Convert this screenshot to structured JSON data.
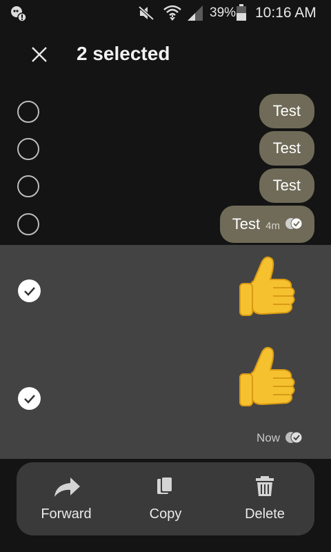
{
  "status_bar": {
    "battery_percent": "39%",
    "time": "10:16 AM",
    "icons": [
      "notification-icon",
      "mute-icon",
      "wifi-icon",
      "signal-icon",
      "battery-icon"
    ]
  },
  "header": {
    "title": "2 selected",
    "close_icon": "close-icon"
  },
  "messages": [
    {
      "text": "Test",
      "selected": false
    },
    {
      "text": "Test",
      "selected": false
    },
    {
      "text": "Test",
      "selected": false
    },
    {
      "text": "Test",
      "time": "4m",
      "selected": false
    },
    {
      "emoji": "thumbs-up",
      "selected": true
    },
    {
      "emoji": "thumbs-up",
      "time": "Now",
      "selected": true
    }
  ],
  "action_bar": {
    "forward_label": "Forward",
    "copy_label": "Copy",
    "delete_label": "Delete"
  },
  "colors": {
    "background": "#141414",
    "bubble": "#6f6b58",
    "selected_background": "#434343",
    "action_bar": "#3a3a3a"
  }
}
